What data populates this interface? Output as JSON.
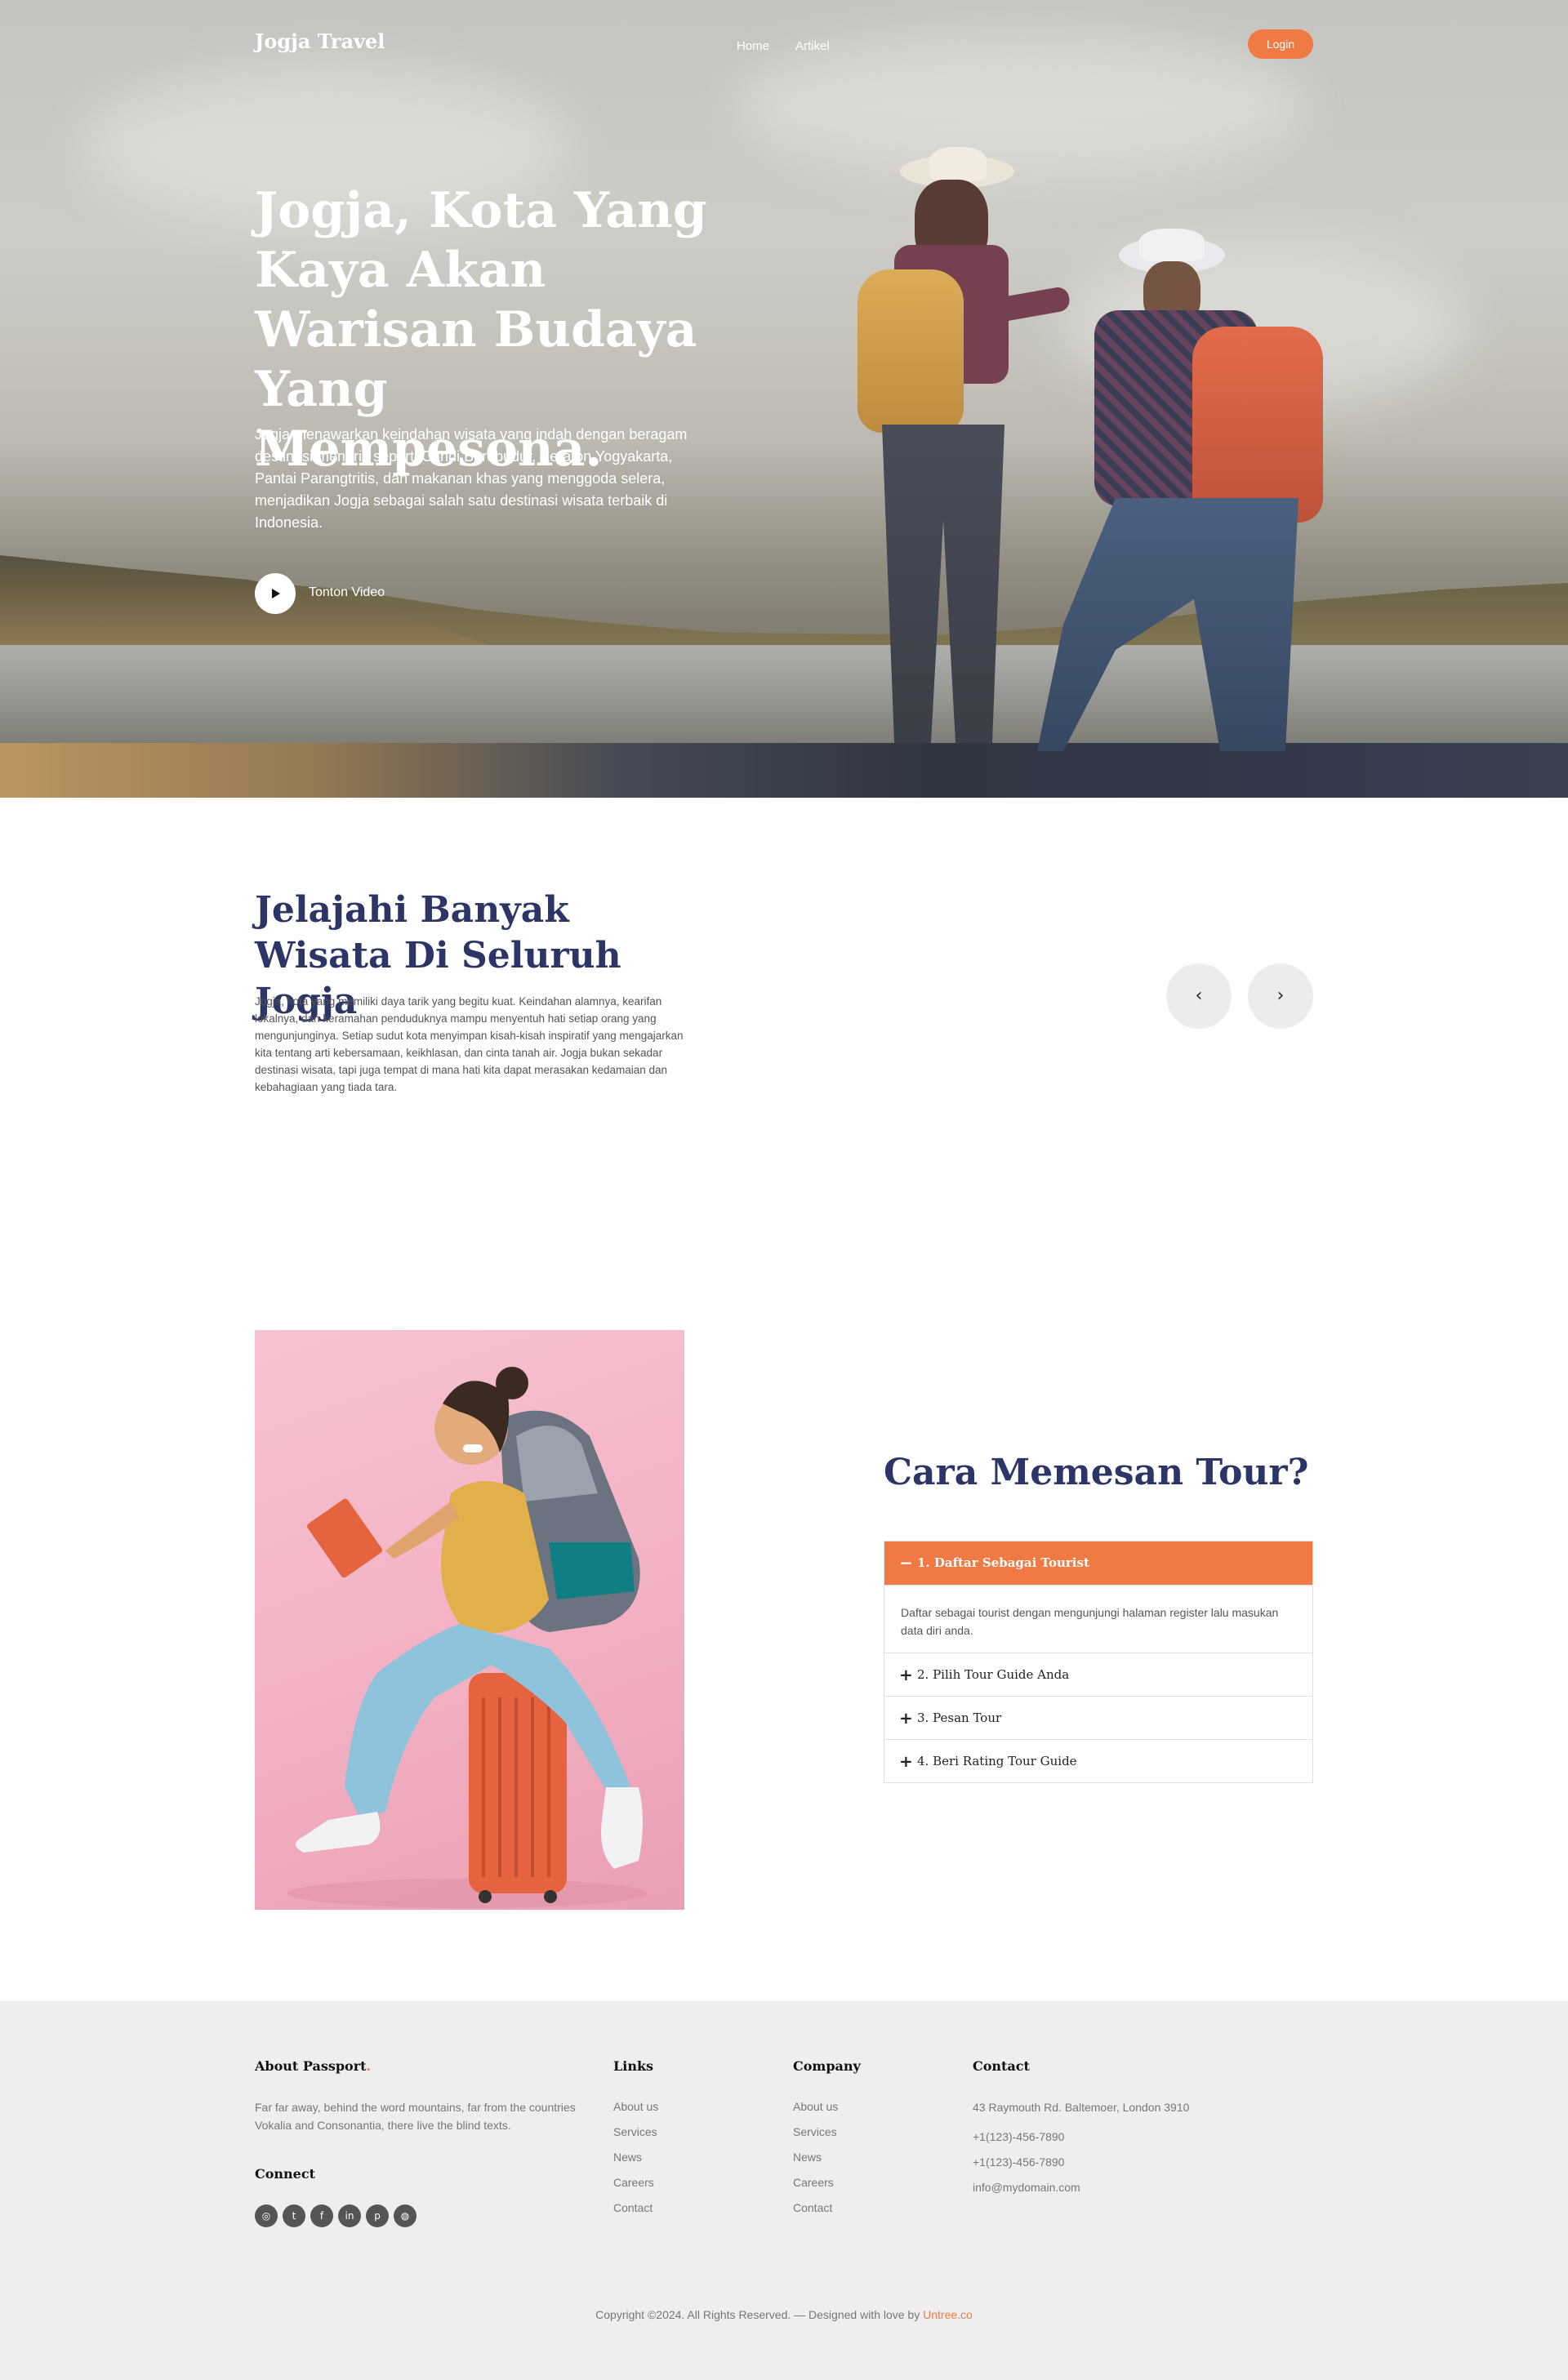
{
  "nav": {
    "brand": "Jogja Travel",
    "links": [
      "Home",
      "Artikel"
    ],
    "login": "Login"
  },
  "hero": {
    "title": "Jogja, Kota Yang Kaya Akan Warisan Budaya Yang Mempesona.",
    "description": "Jogja menawarkan keindahan wisata yang indah dengan beragam destinasi menarik seperti Candi Borobudur, Keraton Yogyakarta, Pantai Parangtritis, dan makanan khas yang menggoda selera, menjadikan Jogja sebagai salah satu destinasi wisata terbaik di Indonesia.",
    "watch_label": "Tonton Video"
  },
  "explore": {
    "title": "Jelajahi Banyak Wisata Di Seluruh Jogja",
    "description": "Jogja, kota yang memiliki daya tarik yang begitu kuat. Keindahan alamnya, kearifan lokalnya, dan keramahan penduduknya mampu menyentuh hati setiap orang yang mengunjunginya. Setiap sudut kota menyimpan kisah-kisah inspiratif yang mengajarkan kita tentang arti kebersamaan, keikhlasan, dan cinta tanah air. Jogja bukan sekadar destinasi wisata, tapi juga tempat di mana hati kita dapat merasakan kedamaian dan kebahagiaan yang tiada tara.",
    "prev_icon": "‹",
    "next_icon": "›"
  },
  "tour": {
    "title": "Cara Memesan Tour?",
    "items": [
      {
        "label": "1. Daftar Sebagai Tourist",
        "symbol": "−",
        "body": "Daftar sebagai tourist dengan mengunjungi halaman register lalu masukan data diri anda."
      },
      {
        "label": "2. Pilih Tour Guide Anda",
        "symbol": "+"
      },
      {
        "label": "3. Pesan Tour",
        "symbol": "+"
      },
      {
        "label": "4. Beri Rating Tour Guide",
        "symbol": "+"
      }
    ]
  },
  "footer": {
    "about_title": "About Passport",
    "about_dot": ".",
    "about_text": "Far far away, behind the word mountains, far from the countries Vokalia and Consonantia, there live the blind texts.",
    "connect_title": "Connect",
    "social_icons": [
      "instagram-icon",
      "twitter-icon",
      "facebook-icon",
      "linkedin-icon",
      "pinterest-icon",
      "dribbble-icon"
    ],
    "links_title": "Links",
    "links": [
      "About us",
      "Services",
      "News",
      "Careers",
      "Contact"
    ],
    "company_title": "Company",
    "company": [
      "About us",
      "Services",
      "News",
      "Careers",
      "Contact"
    ],
    "contact_title": "Contact",
    "address": "43 Raymouth Rd. Baltemoer, London 3910",
    "phone1": "+1(123)-456-7890",
    "phone2": "+1(123)-456-7890",
    "email": "info@mydomain.com",
    "copyright_text": "Copyright ©2024. All Rights Reserved. — Designed with love by ",
    "copyright_link": "Untree.co"
  },
  "colors": {
    "accent": "#f07a43",
    "heading": "#2c3566",
    "footer_bg": "#eeeeee"
  }
}
